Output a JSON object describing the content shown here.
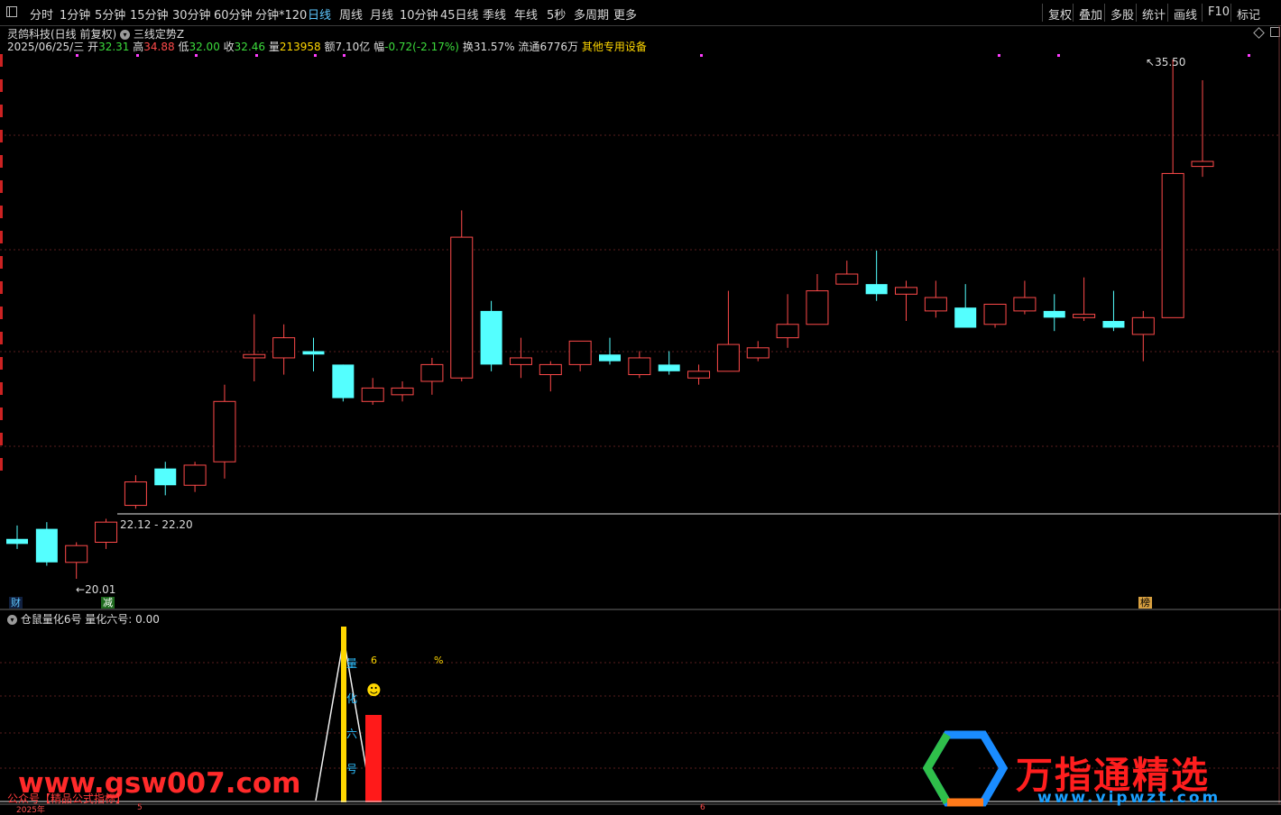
{
  "toolbar": {
    "left_items": [
      "分时",
      "1分钟",
      "5分钟",
      "15分钟",
      "30分钟",
      "60分钟",
      "分钟*120",
      "日线",
      "周线",
      "月线",
      "10分钟",
      "45日线",
      "季线",
      "年线",
      "5秒",
      "多周期",
      "更多"
    ],
    "active_item": "日线",
    "right_items": [
      "复权",
      "叠加",
      "多股",
      "统计",
      "画线",
      "F10",
      "标记"
    ]
  },
  "stock": {
    "name_line": "灵鸽科技(日线 前复权)",
    "indicator_name": "三线定势Z",
    "date": "2025/06/25/三",
    "open_label": "开",
    "open": "32.31",
    "high_label": "高",
    "high": "34.88",
    "low_label": "低",
    "low": "32.00",
    "close_label": "收",
    "close": "32.46",
    "volume_label": "量",
    "volume": "213958",
    "amount_label": "额",
    "amount": "7.10亿",
    "change_label": "幅",
    "change": "-0.72(-2.17%)",
    "turnover_label": "换",
    "turnover": "31.57%",
    "float_label": "流通",
    "float": "6776万",
    "extra": "其他专用设备"
  },
  "annotations": {
    "max_price": "35.50",
    "min_price": "20.01",
    "range_label": "22.12 - 22.20",
    "badge_cai": "财",
    "badge_jian": "减",
    "badge_bang": "榜"
  },
  "sub_panel": {
    "indicator_name": "仓鼠量化6号",
    "indicator_value": "量化六号: 0.00",
    "vertical_text": [
      "量",
      "化",
      "六",
      "号"
    ],
    "six_label": "6",
    "percent_label": "%",
    "smile": "☻"
  },
  "watermarks": {
    "left_site": "www.gsw007.com",
    "wx_line": "公众号【精品公式指标】",
    "brand_title": "万指通精选",
    "brand_url": "www.vipwzt.com"
  },
  "colors": {
    "up": "#ff4a4a",
    "down": "#54ffff",
    "active": "#5fc8ff",
    "yellow": "#ffd700",
    "magenta": "#ff3cff"
  },
  "chart_data": {
    "type": "candlestick",
    "date_axis_labels": [
      "2025年",
      "5",
      "6"
    ],
    "candles": [
      {
        "o": 21.2,
        "h": 21.6,
        "l": 20.9,
        "c": 21.05
      },
      {
        "o": 21.5,
        "h": 21.7,
        "l": 20.4,
        "c": 20.5
      },
      {
        "o": 20.5,
        "h": 21.1,
        "l": 20.01,
        "c": 21.0
      },
      {
        "o": 21.1,
        "h": 21.8,
        "l": 20.9,
        "c": 21.7
      },
      {
        "o": 22.2,
        "h": 23.1,
        "l": 22.1,
        "c": 22.9
      },
      {
        "o": 23.3,
        "h": 23.5,
        "l": 22.5,
        "c": 22.8
      },
      {
        "o": 22.8,
        "h": 23.5,
        "l": 22.6,
        "c": 23.4
      },
      {
        "o": 23.5,
        "h": 25.8,
        "l": 23.0,
        "c": 25.3
      },
      {
        "o": 26.6,
        "h": 27.9,
        "l": 25.9,
        "c": 26.7
      },
      {
        "o": 26.6,
        "h": 27.6,
        "l": 26.1,
        "c": 27.2
      },
      {
        "o": 26.8,
        "h": 27.2,
        "l": 26.2,
        "c": 26.7
      },
      {
        "o": 26.4,
        "h": 26.4,
        "l": 25.3,
        "c": 25.4
      },
      {
        "o": 25.3,
        "h": 26.0,
        "l": 25.2,
        "c": 25.7
      },
      {
        "o": 25.5,
        "h": 25.9,
        "l": 25.3,
        "c": 25.7
      },
      {
        "o": 25.9,
        "h": 26.6,
        "l": 25.5,
        "c": 26.4
      },
      {
        "o": 26.0,
        "h": 31.0,
        "l": 25.9,
        "c": 30.2
      },
      {
        "o": 28.0,
        "h": 28.3,
        "l": 26.2,
        "c": 26.4
      },
      {
        "o": 26.4,
        "h": 27.2,
        "l": 26.0,
        "c": 26.6
      },
      {
        "o": 26.1,
        "h": 26.5,
        "l": 25.6,
        "c": 26.4
      },
      {
        "o": 26.4,
        "h": 27.0,
        "l": 26.2,
        "c": 27.1
      },
      {
        "o": 26.7,
        "h": 27.2,
        "l": 26.4,
        "c": 26.5
      },
      {
        "o": 26.1,
        "h": 26.8,
        "l": 26.0,
        "c": 26.6
      },
      {
        "o": 26.4,
        "h": 26.8,
        "l": 26.1,
        "c": 26.2
      },
      {
        "o": 26.0,
        "h": 26.4,
        "l": 25.8,
        "c": 26.2
      },
      {
        "o": 26.2,
        "h": 28.6,
        "l": 26.2,
        "c": 27.0
      },
      {
        "o": 26.6,
        "h": 27.1,
        "l": 26.5,
        "c": 26.9
      },
      {
        "o": 27.2,
        "h": 28.5,
        "l": 26.9,
        "c": 27.6
      },
      {
        "o": 27.6,
        "h": 29.1,
        "l": 27.6,
        "c": 28.6
      },
      {
        "o": 28.8,
        "h": 29.5,
        "l": 28.8,
        "c": 29.1
      },
      {
        "o": 28.8,
        "h": 29.8,
        "l": 28.3,
        "c": 28.5
      },
      {
        "o": 28.5,
        "h": 28.9,
        "l": 27.7,
        "c": 28.7
      },
      {
        "o": 28.0,
        "h": 28.9,
        "l": 27.8,
        "c": 28.4
      },
      {
        "o": 28.1,
        "h": 28.8,
        "l": 28.0,
        "c": 27.5
      },
      {
        "o": 27.6,
        "h": 28.1,
        "l": 27.5,
        "c": 28.2
      },
      {
        "o": 28.0,
        "h": 28.9,
        "l": 27.9,
        "c": 28.4
      },
      {
        "o": 28.0,
        "h": 28.5,
        "l": 27.4,
        "c": 27.8
      },
      {
        "o": 27.8,
        "h": 29.0,
        "l": 27.7,
        "c": 27.9
      },
      {
        "o": 27.7,
        "h": 28.6,
        "l": 27.4,
        "c": 27.5
      },
      {
        "o": 27.3,
        "h": 28.0,
        "l": 26.5,
        "c": 27.8
      },
      {
        "o": 27.8,
        "h": 35.5,
        "l": 27.8,
        "c": 32.1
      },
      {
        "o": 32.31,
        "h": 34.88,
        "l": 32.0,
        "c": 32.46
      }
    ]
  }
}
